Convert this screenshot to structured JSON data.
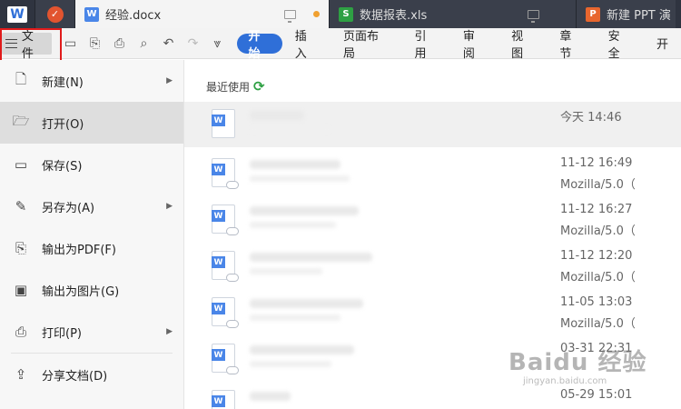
{
  "tabs": {
    "logo": "W",
    "items": [
      {
        "icon": "W",
        "name": "经验.docx"
      },
      {
        "icon": "S",
        "name": "数据报表.xls"
      },
      {
        "icon": "P",
        "name": "新建 PPT 演"
      }
    ]
  },
  "toolbar": {
    "file_label": "文件",
    "ribbon_tabs": [
      "开始",
      "插入",
      "页面布局",
      "引用",
      "审阅",
      "视图",
      "章节",
      "安全",
      "开"
    ]
  },
  "menu": {
    "items": [
      {
        "label": "新建(N)",
        "icon": "new-file-icon",
        "has_submenu": true
      },
      {
        "label": "打开(O)",
        "icon": "folder-icon",
        "has_submenu": false
      },
      {
        "label": "保存(S)",
        "icon": "save-icon",
        "has_submenu": false
      },
      {
        "label": "另存为(A)",
        "icon": "save-as-icon",
        "has_submenu": true
      },
      {
        "label": "输出为PDF(F)",
        "icon": "pdf-icon",
        "has_submenu": false
      },
      {
        "label": "输出为图片(G)",
        "icon": "image-icon",
        "has_submenu": false
      },
      {
        "label": "打印(P)",
        "icon": "printer-icon",
        "has_submenu": true
      },
      {
        "label": "分享文档(D)",
        "icon": "share-icon",
        "has_submenu": false
      }
    ]
  },
  "recent": {
    "title": "最近使用",
    "files": [
      {
        "time": "今天 14:46",
        "source": ""
      },
      {
        "time": "11-12 16:49",
        "source": "Mozilla/5.0（"
      },
      {
        "time": "11-12 16:27",
        "source": "Mozilla/5.0（"
      },
      {
        "time": "11-12 12:20",
        "source": "Mozilla/5.0（"
      },
      {
        "time": "11-05 13:03",
        "source": "Mozilla/5.0（"
      },
      {
        "time": "03-31 22:31",
        "source": ""
      },
      {
        "time": "05-29 15:01",
        "source": ""
      }
    ]
  },
  "watermark": {
    "brand": "Baidu 经验",
    "url": "jingyan.baidu.com"
  },
  "colors": {
    "accent": "#2f6fd8",
    "highlight_box": "#e01b1b",
    "tab_bar": "#2f3440"
  }
}
